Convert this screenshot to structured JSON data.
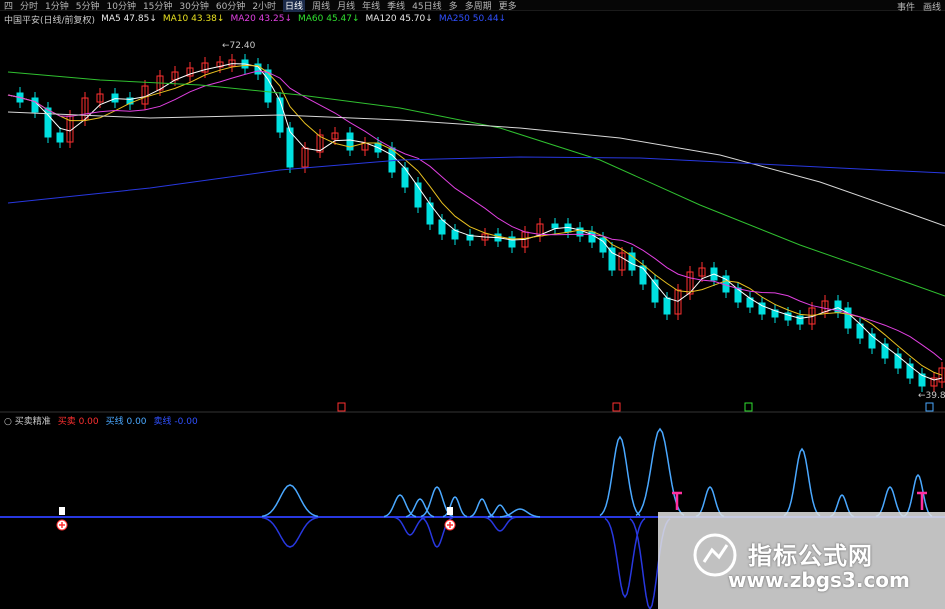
{
  "toolbar": {
    "items": [
      "四",
      "分时",
      "1分钟",
      "5分钟",
      "10分钟",
      "15分钟",
      "30分钟",
      "60分钟",
      "2小时",
      "日线",
      "周线",
      "月线",
      "年线",
      "季线",
      "45日线",
      "多",
      "多周期",
      "更多"
    ],
    "active_index": 9,
    "right": [
      "事件",
      "画线"
    ]
  },
  "ma_legend": [
    {
      "label": "MA5",
      "value": "47.85",
      "color": "#e8e8e8"
    },
    {
      "label": "MA10",
      "value": "43.38",
      "color": "#e8e020"
    },
    {
      "label": "MA20",
      "value": "43.25",
      "color": "#e040e0"
    },
    {
      "label": "MA60",
      "value": "45.47",
      "color": "#30e030"
    },
    {
      "label": "MA120",
      "value": "45.70",
      "color": "#e8e8e8"
    },
    {
      "label": "MA250",
      "value": "50.44",
      "color": "#3050ff"
    }
  ],
  "ma_prefix": "中国平安(日线/前复权)",
  "high_label": "72.40",
  "low_label": "39.8",
  "indicator": {
    "name": "买卖精准",
    "items": [
      {
        "label": "买卖",
        "value": "0.00",
        "color": "#ff3030"
      },
      {
        "label": "买线",
        "value": "0.00",
        "color": "#4aa8ff"
      },
      {
        "label": "卖线",
        "value": "-0.00",
        "color": "#3050ff"
      }
    ]
  },
  "watermark": {
    "title": "指标公式网",
    "url": "www.zbgs3.com"
  },
  "colors": {
    "up": "#ff3030",
    "down": "#00e0e0",
    "ma5": "#ffffff",
    "ma10": "#e8c020",
    "ma20": "#e040e0",
    "ma60": "#30c030",
    "ma120": "#d8d8d8",
    "ma250": "#2838e0",
    "buyline": "#4aa8ff",
    "sellline": "#2838e0"
  }
}
